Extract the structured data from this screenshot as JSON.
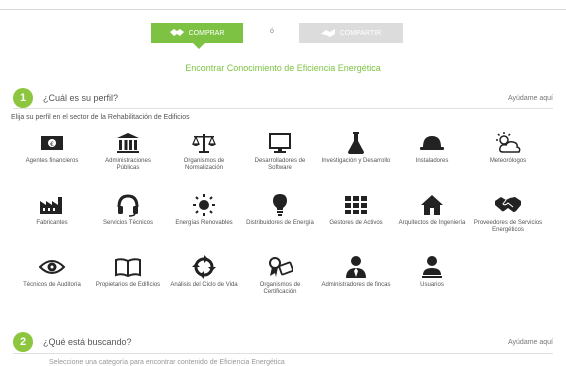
{
  "header": {
    "active_toggle_label": "COMPRAR",
    "or_label": "ó",
    "inactive_toggle_label": "COMPARTIR",
    "subtitle": "Encontrar Conocimiento de Eficiencia Energética"
  },
  "section1": {
    "number": "1",
    "title": "¿Cuál es su perfil?",
    "action": "Ayúdame aquí",
    "instruction": "Elija su perfil en el sector de la Rehabilitación de Edificios"
  },
  "profiles": [
    {
      "label": "Agentes financieros",
      "icon": "bank-card-icon"
    },
    {
      "label": "Administraciones Públicas",
      "icon": "government-building-icon"
    },
    {
      "label": "Organismos de Normalización",
      "icon": "balance-scale-icon"
    },
    {
      "label": "Desarrolladores de Software",
      "icon": "monitor-icon"
    },
    {
      "label": "Investigación y Desarrollo",
      "icon": "flask-icon"
    },
    {
      "label": "Instaladores",
      "icon": "hard-hat-icon"
    },
    {
      "label": "Meteorólogos",
      "icon": "weather-icon"
    },
    {
      "label": "Fabricantes",
      "icon": "factory-icon"
    },
    {
      "label": "Servicios Técnicos",
      "icon": "headset-icon"
    },
    {
      "label": "Energías Renovables",
      "icon": "sun-icon"
    },
    {
      "label": "Distribuidores de Energía",
      "icon": "light-bulb-icon"
    },
    {
      "label": "Gestores de Activos",
      "icon": "grid-icon"
    },
    {
      "label": "Arquitectos de Ingeniería",
      "icon": "house-icon"
    },
    {
      "label": "Proveedores de Servicios Energéticos",
      "icon": "handshake-icon"
    },
    {
      "label": "Técnicos de Auditoría",
      "icon": "eye-icon"
    },
    {
      "label": "Propietarios de Edificios",
      "icon": "book-icon"
    },
    {
      "label": "Análisis del Ciclo de Vida",
      "icon": "cycle-icon"
    },
    {
      "label": "Organismos de Certificación",
      "icon": "certificate-icon"
    },
    {
      "label": "Administradores de fincas",
      "icon": "manager-icon"
    },
    {
      "label": "Usuarios",
      "icon": "user-icon"
    }
  ],
  "section2": {
    "number": "2",
    "title": "¿Qué está buscando?",
    "action": "Ayúdame aquí",
    "instruction": "Seleccione una categoría para encontrar contenido de Eficiencia Energética"
  },
  "colors": {
    "accent": "#7dc242",
    "inactive": "#dcdcdc",
    "icon": "#222222"
  }
}
